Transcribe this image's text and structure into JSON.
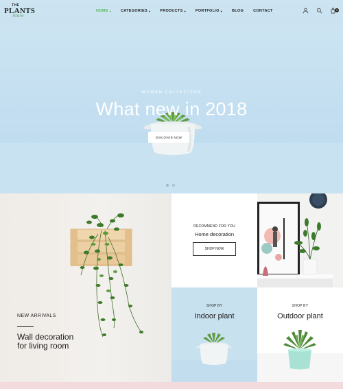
{
  "header": {
    "logo": {
      "the": "THE",
      "plants": "PLANTS",
      "store": "Store"
    },
    "nav": [
      {
        "label": "HOME",
        "caret": "▾",
        "active": true
      },
      {
        "label": "CATEGORIES",
        "caret": "▾"
      },
      {
        "label": "PRODUCTS",
        "caret": "▾"
      },
      {
        "label": "PORTFOLIO",
        "caret": "▾"
      },
      {
        "label": "BLOG",
        "caret": ""
      },
      {
        "label": "CONTACT",
        "caret": ""
      }
    ],
    "icons": [
      "user-icon",
      "search-icon",
      "cart-icon"
    ],
    "cart_count": "0"
  },
  "hero": {
    "subtitle": "WOMEN COLLECTION",
    "title": "What new in 2018",
    "button_label": "DISCOVER NOW",
    "slides": 2
  },
  "new_arrivals": {
    "label": "NEW ARRIVALS",
    "title_line1": "Wall decoration",
    "title_line2": "for living room"
  },
  "recommend": {
    "label": "RECOMMEND FOR YOU",
    "title": "Home decoration",
    "button_label": "SHOP NOW"
  },
  "indoor": {
    "label": "SHOP BY",
    "title": "Indoor plant"
  },
  "outdoor": {
    "label": "SHOP BY",
    "title": "Outdoor plant"
  },
  "colors": {
    "accent": "#5ab35c",
    "hero_bg": "#c7e1f0",
    "footer_strip": "#f3dadd"
  }
}
